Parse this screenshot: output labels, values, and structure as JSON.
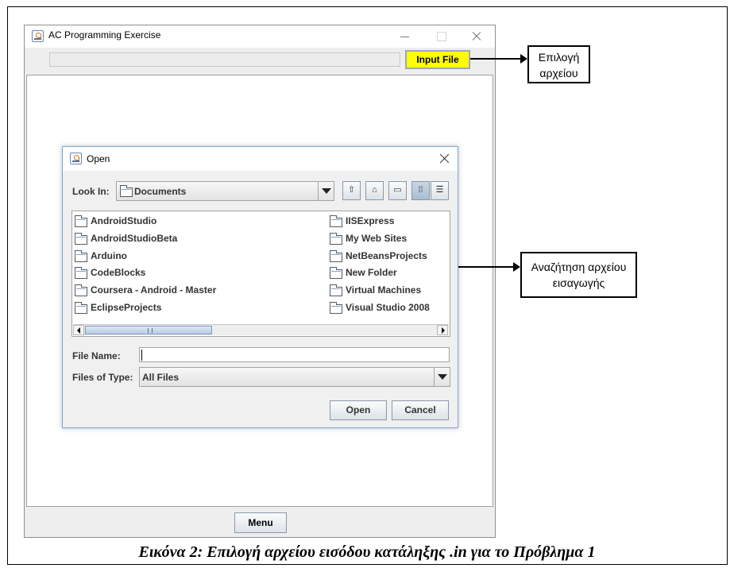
{
  "main_window": {
    "title": "AC Programming Exercise",
    "input_file_label": "Input File",
    "input_file_color": "#ffff00",
    "menu_label": "Menu"
  },
  "annotations": {
    "select_file": [
      "Επιλογή",
      "αρχείου"
    ],
    "browse_input": [
      "Αναζήτηση αρχείου",
      "εισαγωγής"
    ]
  },
  "dialog": {
    "title": "Open",
    "look_in_label": "Look In:",
    "look_in_value": "Documents",
    "toolbar_icons": [
      "up-folder-icon",
      "home-icon",
      "new-folder-icon",
      "list-view-icon",
      "details-view-icon"
    ],
    "folders_col1": [
      "AndroidStudio",
      "AndroidStudioBeta",
      "Arduino",
      "CodeBlocks",
      "Coursera - Android - Master",
      "EclipseProjects"
    ],
    "folders_col2": [
      "IISExpress",
      "My Web Sites",
      "NetBeansProjects",
      "New Folder",
      "Virtual Machines",
      "Visual Studio 2008"
    ],
    "file_name_label": "File Name:",
    "file_name_value": "",
    "files_of_type_label": "Files of Type:",
    "files_of_type_value": "All Files",
    "open_label": "Open",
    "cancel_label": "Cancel"
  },
  "caption": "Εικόνα 2: Επιλογή αρχείου εισόδου κατάληξης .in για το Πρόβλημα 1"
}
